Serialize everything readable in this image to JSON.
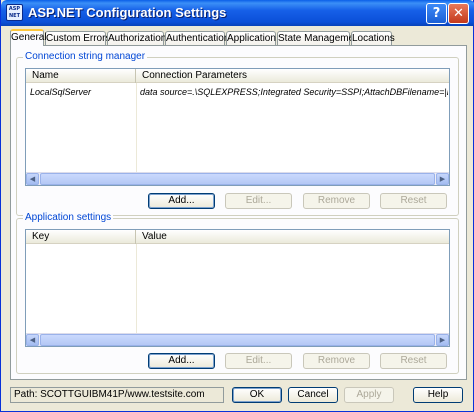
{
  "window": {
    "title": "ASP.NET Configuration Settings",
    "icon_text": "ASP NET",
    "help_label": "?",
    "close_label": "✕"
  },
  "tabs": [
    {
      "label": "General",
      "active": true
    },
    {
      "label": "Custom Errors"
    },
    {
      "label": "Authorization"
    },
    {
      "label": "Authentication"
    },
    {
      "label": "Application"
    },
    {
      "label": "State Management"
    },
    {
      "label": "Locations"
    }
  ],
  "connection_strings": {
    "group_label": "Connection string manager",
    "columns": [
      "Name",
      "Connection Parameters"
    ],
    "rows": [
      {
        "name": "LocalSqlServer",
        "params": "data source=.\\SQLEXPRESS;Integrated Security=SSPI;AttachDBFilename=|DataDi"
      }
    ],
    "buttons": {
      "add": "Add...",
      "edit": "Edit...",
      "remove": "Remove",
      "reset": "Reset"
    }
  },
  "app_settings": {
    "group_label": "Application settings",
    "columns": [
      "Key",
      "Value"
    ],
    "rows": [],
    "buttons": {
      "add": "Add...",
      "edit": "Edit...",
      "remove": "Remove",
      "reset": "Reset"
    }
  },
  "footer": {
    "path": "Path: SCOTTGUIBM41P/www.testsite.com",
    "ok": "OK",
    "cancel": "Cancel",
    "apply": "Apply",
    "help": "Help"
  },
  "colors": {
    "title_bar": "#0b4fd8",
    "group_label": "#0046d5",
    "tab_highlight": "#ffc83c"
  }
}
